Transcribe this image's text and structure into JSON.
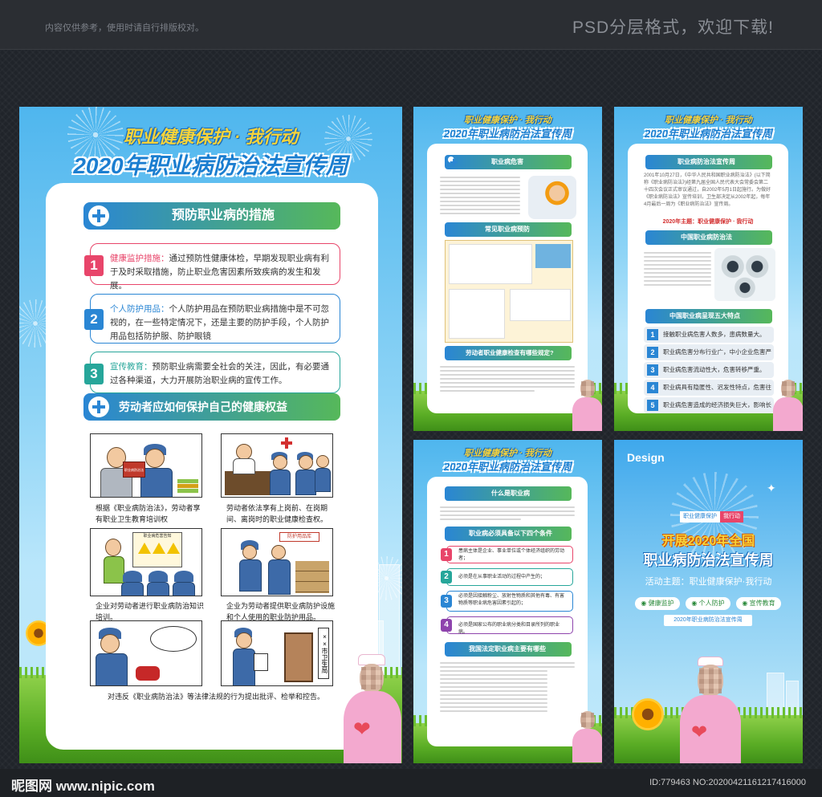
{
  "header": {
    "notice": "内容仅供参考，使用时请自行排版校对。",
    "format": "PSD分层格式，欢迎下载!"
  },
  "footer": {
    "site": "昵图网 www.nipic.com",
    "id": "ID:779463 NO:20200421161217416000"
  },
  "poster1": {
    "slogan": "职业健康保护 · 我行动",
    "title": "2020年职业病防治法宣传周",
    "section1": "预防职业病的措施",
    "items": [
      {
        "num": "1",
        "head": "健康监护措施：",
        "text": "通过预防性健康体检，早期发现职业病有利于及时采取措施，防止职业危害因素所致疾病的发生和发展。",
        "color": "#e8456a"
      },
      {
        "num": "2",
        "head": "个人防护用品：",
        "text": "个人防护用品在预防职业病措施中是不可忽视的，在一些特定情况下，还是主要的防护手段，个人防护用品包括防护服、防护眼镜",
        "color": "#2a86d4"
      },
      {
        "num": "3",
        "head": "宣传教育：",
        "text": "预防职业病需要全社会的关注，因此，有必要通过各种渠道，大力开展防治职业病的宣传工作。",
        "color": "#26a69a"
      }
    ],
    "section2": "劳动者应如何保护自己的健康权益",
    "captions": [
      "根据《职业病防治法》，劳动者享有职业卫生教育培训权",
      "劳动者依法享有上岗前、在岗期间、离岗时的职业健康检查权。",
      "企业对劳动者进行职业病防治知识培训。",
      "企业为劳动者提供职业病防护设施和个人使用的职业防护用品。",
      "对违反《职业病防治法》等法律法规的行为提出批评、检举和控告。"
    ],
    "sign_board": "职业病危害告知",
    "sign_box": "防护用品库",
    "door_sign": "××市卫生局",
    "book_label": "职业病防治法"
  },
  "poster2": {
    "slogan": "职业健康保护 · 我行动",
    "title": "2020年职业病防治法宣传周",
    "section1": "职业病危害",
    "section2": "常见职业病预防",
    "section3": "劳动者职业健康检查有哪些规定?"
  },
  "poster3": {
    "slogan": "职业健康保护 · 我行动",
    "title": "2020年职业病防治法宣传周",
    "section1": "职业病防治法宣传周",
    "intro": "2001年10月27日，《中华人民共和国职业病防治法》(以下简称《职业病防治法》)经第九届全国人民代表大会常委会第二十四次会议正式审议通过，自2002年5月1日起施行。为做好《职业病防治法》宣传培训，卫生部决定从2002年起，每年4月最后一周为《职业病防治法》宣传周。",
    "theme": "2020年主题：职业健康保护 · 我行动",
    "section2": "中国职业病防治法",
    "section3": "中国职业病呈现五大特点",
    "features": [
      "接触职业病危害人数多，患病数量大。",
      "职业病危害分布行业广，中小企业危害严重。",
      "职业病危害流动性大，危害转移严重。",
      "职业病具有隐匿性、迟发性特点，危害往往被忽视。",
      "职业病危害造成的经济损失巨大，影响长远。"
    ]
  },
  "poster4": {
    "slogan": "职业健康保护 · 我行动",
    "title": "2020年职业病防治法宣传周",
    "section1": "什么是职业病",
    "section2": "职业病必须具备以下四个条件",
    "conditions": [
      {
        "num": "1",
        "text": "患病主体是企业、事业单位或个体经济组织的劳动者；",
        "color": "#e8456a"
      },
      {
        "num": "2",
        "text": "必须是在从事职业活动的过程中产生的；",
        "color": "#26a69a"
      },
      {
        "num": "3",
        "text": "必须是因接触粉尘、放射性物质和其他有毒、有害物质等职业病危害因素引起的；",
        "color": "#2a86d4"
      },
      {
        "num": "4",
        "text": "必须是国家公布的职业病分类和目录所列的职业病。",
        "color": "#8e44ad"
      }
    ],
    "section3": "我国法定职业病主要有哪些"
  },
  "poster5": {
    "brand": "Design",
    "tag_left": "职业健康保护",
    "tag_right": "我行动",
    "headline1": "开展2020年全国",
    "headline2": "职业病防治法宣传周",
    "theme": "活动主题：职业健康保护·我行动",
    "pills": [
      "健康监护",
      "个人防护",
      "宣传教育"
    ],
    "ribbon": "2020年职业病防治法宣传周"
  }
}
